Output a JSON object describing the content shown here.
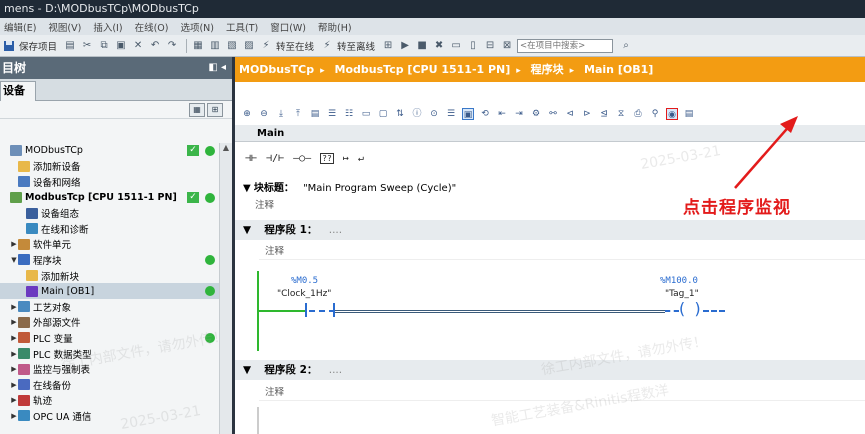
{
  "titlebar": {
    "title": "mens - D:\\MODbusTCp\\MODbusTCp"
  },
  "menu": [
    "编辑(E)",
    "视图(V)",
    "插入(I)",
    "在线(O)",
    "选项(N)",
    "工具(T)",
    "窗口(W)",
    "帮助(H)"
  ],
  "toolbar": {
    "save_project": "保存项目",
    "go_online": "转至在线",
    "go_offline": "转至离线",
    "search_placeholder": "<在项目中搜索>"
  },
  "left_pane": {
    "header": "目树",
    "tab": "设备",
    "tree": [
      {
        "label": "MODbusTCp",
        "level": 0,
        "icon": "project-icon",
        "check": true,
        "dot": true
      },
      {
        "label": "添加新设备",
        "level": 1,
        "icon": "add-device-icon"
      },
      {
        "label": "设备和网络",
        "level": 1,
        "icon": "network-icon"
      },
      {
        "label": "ModbusTcp [CPU 1511-1 PN]",
        "level": 0,
        "icon": "plc-icon",
        "bold": true,
        "check": true,
        "dot": true
      },
      {
        "label": "设备组态",
        "level": 2,
        "icon": "device-config-icon"
      },
      {
        "label": "在线和诊断",
        "level": 2,
        "icon": "diagnostics-icon"
      },
      {
        "label": "软件单元",
        "level": 1,
        "icon": "software-unit-icon",
        "expand": true
      },
      {
        "label": "程序块",
        "level": 1,
        "icon": "program-blocks-icon",
        "expand": true,
        "open": true,
        "dot": true
      },
      {
        "label": "添加新块",
        "level": 2,
        "icon": "add-block-icon"
      },
      {
        "label": "Main [OB1]",
        "level": 2,
        "icon": "ob-icon",
        "selected": true,
        "dot": true
      },
      {
        "label": "工艺对象",
        "level": 1,
        "icon": "technology-objects-icon",
        "expand": true
      },
      {
        "label": "外部源文件",
        "level": 1,
        "icon": "external-source-icon",
        "expand": true
      },
      {
        "label": "PLC 变量",
        "level": 1,
        "icon": "plc-tags-icon",
        "expand": true,
        "dot": true
      },
      {
        "label": "PLC 数据类型",
        "level": 1,
        "icon": "plc-datatypes-icon",
        "expand": true
      },
      {
        "label": "监控与强制表",
        "level": 1,
        "icon": "watch-table-icon",
        "expand": true
      },
      {
        "label": "在线备份",
        "level": 1,
        "icon": "online-backup-icon",
        "expand": true
      },
      {
        "label": "轨迹",
        "level": 1,
        "icon": "traces-icon",
        "expand": true
      },
      {
        "label": "OPC UA 通信",
        "level": 1,
        "icon": "opcua-icon",
        "expand": true
      }
    ]
  },
  "editor": {
    "breadcrumb": [
      "MODbusTCp",
      "ModbusTcp [CPU 1511-1 PN]",
      "程序块",
      "Main [OB1]"
    ],
    "block_tab": "Main",
    "instructions": [
      "⊣⊢",
      "⊣/⊢",
      "–○–",
      "??",
      "↦",
      "↵"
    ],
    "block_title_label": "块标题：",
    "block_title_value": "\"Main Program Sweep (Cycle)\"",
    "block_comment": "注释",
    "networks": [
      {
        "label": "程序段 1：",
        "dots": "....",
        "comment": "注释"
      },
      {
        "label": "程序段 2：",
        "dots": "....",
        "comment": "注释"
      }
    ],
    "contact": {
      "address": "%M0.5",
      "tag": "\"Clock_1Hz\""
    },
    "coil": {
      "address": "%M100.0",
      "tag": "\"Tag_1\""
    }
  },
  "annotation": {
    "text": "点击程序监视"
  },
  "watermarks": [
    "徐工内部文件，请勿外传！",
    "智能工艺装备&Rinitis程数洋",
    "2025-03-21"
  ],
  "colors": {
    "breadcrumb_bg": "#f39c12",
    "annotation_red": "#e31b1b",
    "status_green": "#2fb43c",
    "powerflow_green": "#2eb82e",
    "ladder_blue": "#2a6cd0"
  }
}
